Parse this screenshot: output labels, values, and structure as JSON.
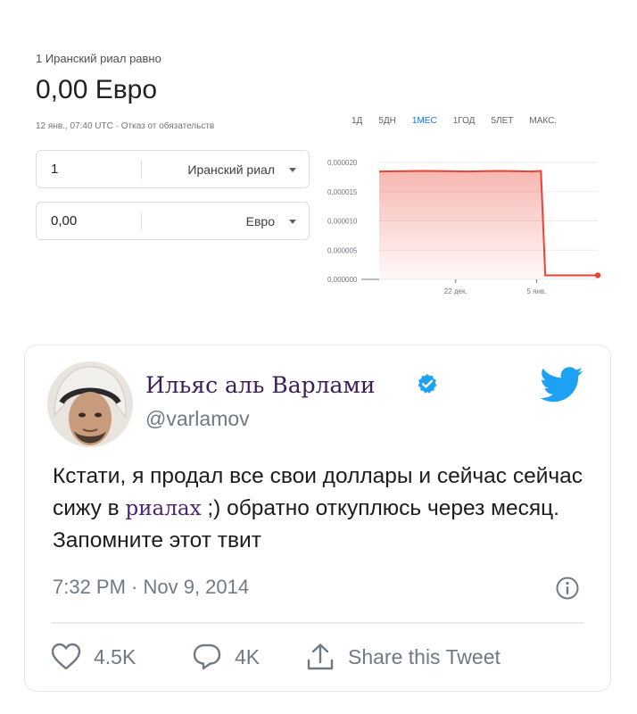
{
  "converter": {
    "label": "1 Иранский риал равно",
    "result": "0,00 Евро",
    "timestamp": "12 янв., 07:40 UTC",
    "separator": " · ",
    "disclaimer": "Отказ от обязательств",
    "from": {
      "amount": "1",
      "currency": "Иранский риал"
    },
    "to": {
      "amount": "0,00",
      "currency": "Евро"
    }
  },
  "ranges": [
    "1Д",
    "5ДН",
    "1МЕС",
    "1ГОД",
    "5ЛЕТ",
    "МАКС."
  ],
  "active_range": "1МЕС",
  "chart_data": {
    "type": "area",
    "y_ticks": [
      "0,000020",
      "0,000015",
      "0,000010",
      "0,000005",
      "0,000000"
    ],
    "x_ticks": [
      "22 дек.",
      "5 янв."
    ],
    "ylim": [
      0,
      2.2e-05
    ],
    "grid": true,
    "color": "#ea4335",
    "points": [
      [
        0,
        2e-05
      ],
      [
        0.2,
        2.01e-05
      ],
      [
        0.4,
        2e-05
      ],
      [
        0.55,
        2.01e-05
      ],
      [
        0.7,
        2e-05
      ],
      [
        0.74,
        2.01e-05
      ],
      [
        0.76,
        7.5e-07
      ],
      [
        1.0,
        7.5e-07
      ]
    ]
  },
  "tweet": {
    "name": "Ильяс аль Варлами",
    "handle": "@varlamov",
    "text_before": "Кстати, я продал все свои доллары и сейчас сейчас сижу в ",
    "text_highlight": "риалах",
    "text_after": " ;) обратно откуплюсь через месяц. Запомните этот твит",
    "time": "7:32 PM · Nov 9, 2014",
    "likes": "4.5K",
    "replies": "4K",
    "share": "Share this Tweet"
  },
  "colors": {
    "accent": "#1a73e8",
    "chart": "#ea4335",
    "twitter": "#1da1f2",
    "name": "#3d1d55"
  }
}
